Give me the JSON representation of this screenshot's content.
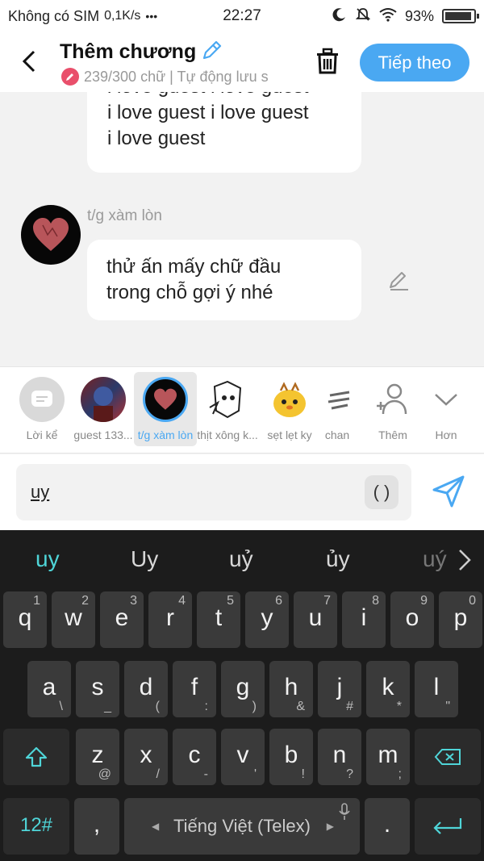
{
  "status_bar": {
    "carrier": "Không có SIM",
    "speed": "0,1K/s",
    "dots": "•••",
    "time": "22:27",
    "battery": "93%",
    "battery_level": 0.93
  },
  "header": {
    "title": "Thêm chương",
    "subtitle": "239/300 chữ | Tự động lưu s",
    "next_label": "Tiếp theo"
  },
  "messages": [
    {
      "lines": [
        "i love guest i love guest",
        "i love guest i love guest",
        "i love guest"
      ]
    },
    {
      "author": "t/g xàm lòn",
      "lines": [
        "thử ấn mấy chữ đầu",
        "trong chỗ gợi ý nhé"
      ]
    }
  ],
  "characters": [
    {
      "label": "Lời kể",
      "icon": "narration-icon"
    },
    {
      "label": "guest 133...",
      "icon": "avatar-guest"
    },
    {
      "label": "t/g xàm lòn",
      "icon": "heart-avatar",
      "selected": true
    },
    {
      "label": "thịt xông k...",
      "icon": "avatar-sketch"
    },
    {
      "label": "sẹt lẹt ky",
      "icon": "avatar-chick"
    },
    {
      "label": "chan",
      "icon": "avatar-chan"
    },
    {
      "label": "Thêm",
      "icon": "add-person-icon"
    },
    {
      "label": "Hơn",
      "icon": "chevron-down-icon"
    }
  ],
  "input": {
    "value": "uy",
    "paren_label": "( )"
  },
  "keyboard": {
    "suggestions": [
      "uy",
      "Uy",
      "uỷ",
      "ủy",
      "uý"
    ],
    "row1": [
      {
        "k": "q",
        "s": "1"
      },
      {
        "k": "w",
        "s": "2"
      },
      {
        "k": "e",
        "s": "3"
      },
      {
        "k": "r",
        "s": "4"
      },
      {
        "k": "t",
        "s": "5"
      },
      {
        "k": "y",
        "s": "6"
      },
      {
        "k": "u",
        "s": "7"
      },
      {
        "k": "i",
        "s": "8"
      },
      {
        "k": "o",
        "s": "9"
      },
      {
        "k": "p",
        "s": "0"
      }
    ],
    "row2": [
      {
        "k": "a",
        "s": "\\"
      },
      {
        "k": "s",
        "s": "_"
      },
      {
        "k": "d",
        "s": "("
      },
      {
        "k": "f",
        "s": ":"
      },
      {
        "k": "g",
        "s": ")"
      },
      {
        "k": "h",
        "s": "&"
      },
      {
        "k": "j",
        "s": "#"
      },
      {
        "k": "k",
        "s": "*"
      },
      {
        "k": "l",
        "s": "\""
      }
    ],
    "row3": [
      {
        "k": "z",
        "s": "@"
      },
      {
        "k": "x",
        "s": "/"
      },
      {
        "k": "c",
        "s": "-"
      },
      {
        "k": "v",
        "s": "'"
      },
      {
        "k": "b",
        "s": "!"
      },
      {
        "k": "n",
        "s": "?"
      },
      {
        "k": "m",
        "s": ";"
      }
    ],
    "num_label": "12#",
    "comma": ",",
    "space_label": "Tiếng Việt (Telex)",
    "period": "."
  }
}
